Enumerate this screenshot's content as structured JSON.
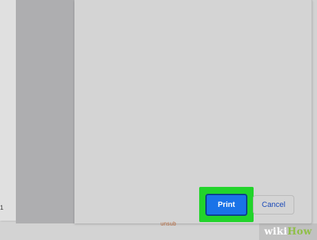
{
  "preview": {
    "page_fragment_text": "1",
    "footer_text": "unsub"
  },
  "dialog": {
    "print_label": "Print",
    "cancel_label": "Cancel"
  },
  "watermark": {
    "wiki": "wiki",
    "how": "How"
  },
  "colors": {
    "primary_button": "#1a73e8",
    "cancel_text": "#1a49b8",
    "highlight": "#22d42b"
  }
}
